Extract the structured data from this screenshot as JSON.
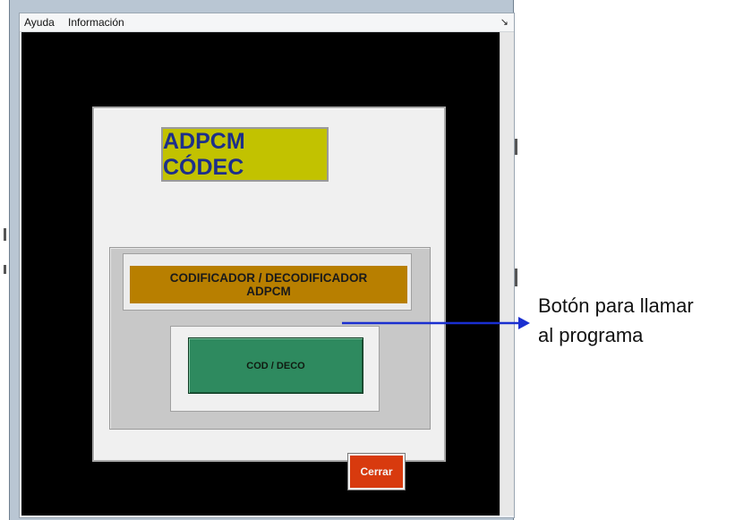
{
  "menu": {
    "items": [
      {
        "label": "Ayuda"
      },
      {
        "label": "Información"
      }
    ]
  },
  "window": {
    "resize_icon": "resize-grip-icon"
  },
  "app": {
    "title": "ADPCM CÓDEC",
    "label_line1": "CODIFICADOR / DECODIFICADOR",
    "label_line2": "ADPCM",
    "cod_button": "COD / DECO",
    "close_button": "Cerrar"
  },
  "annotation": {
    "line1": "Botón para llamar",
    "line2": "al programa"
  },
  "colors": {
    "canvas": "#000000",
    "title_bg": "#c2c200",
    "title_text": "#1d2f8a",
    "label_bg": "#b87f00",
    "cod_button_bg": "#2e8a5f",
    "close_button_bg": "#d83a0e",
    "arrow": "#1a2fd0"
  }
}
